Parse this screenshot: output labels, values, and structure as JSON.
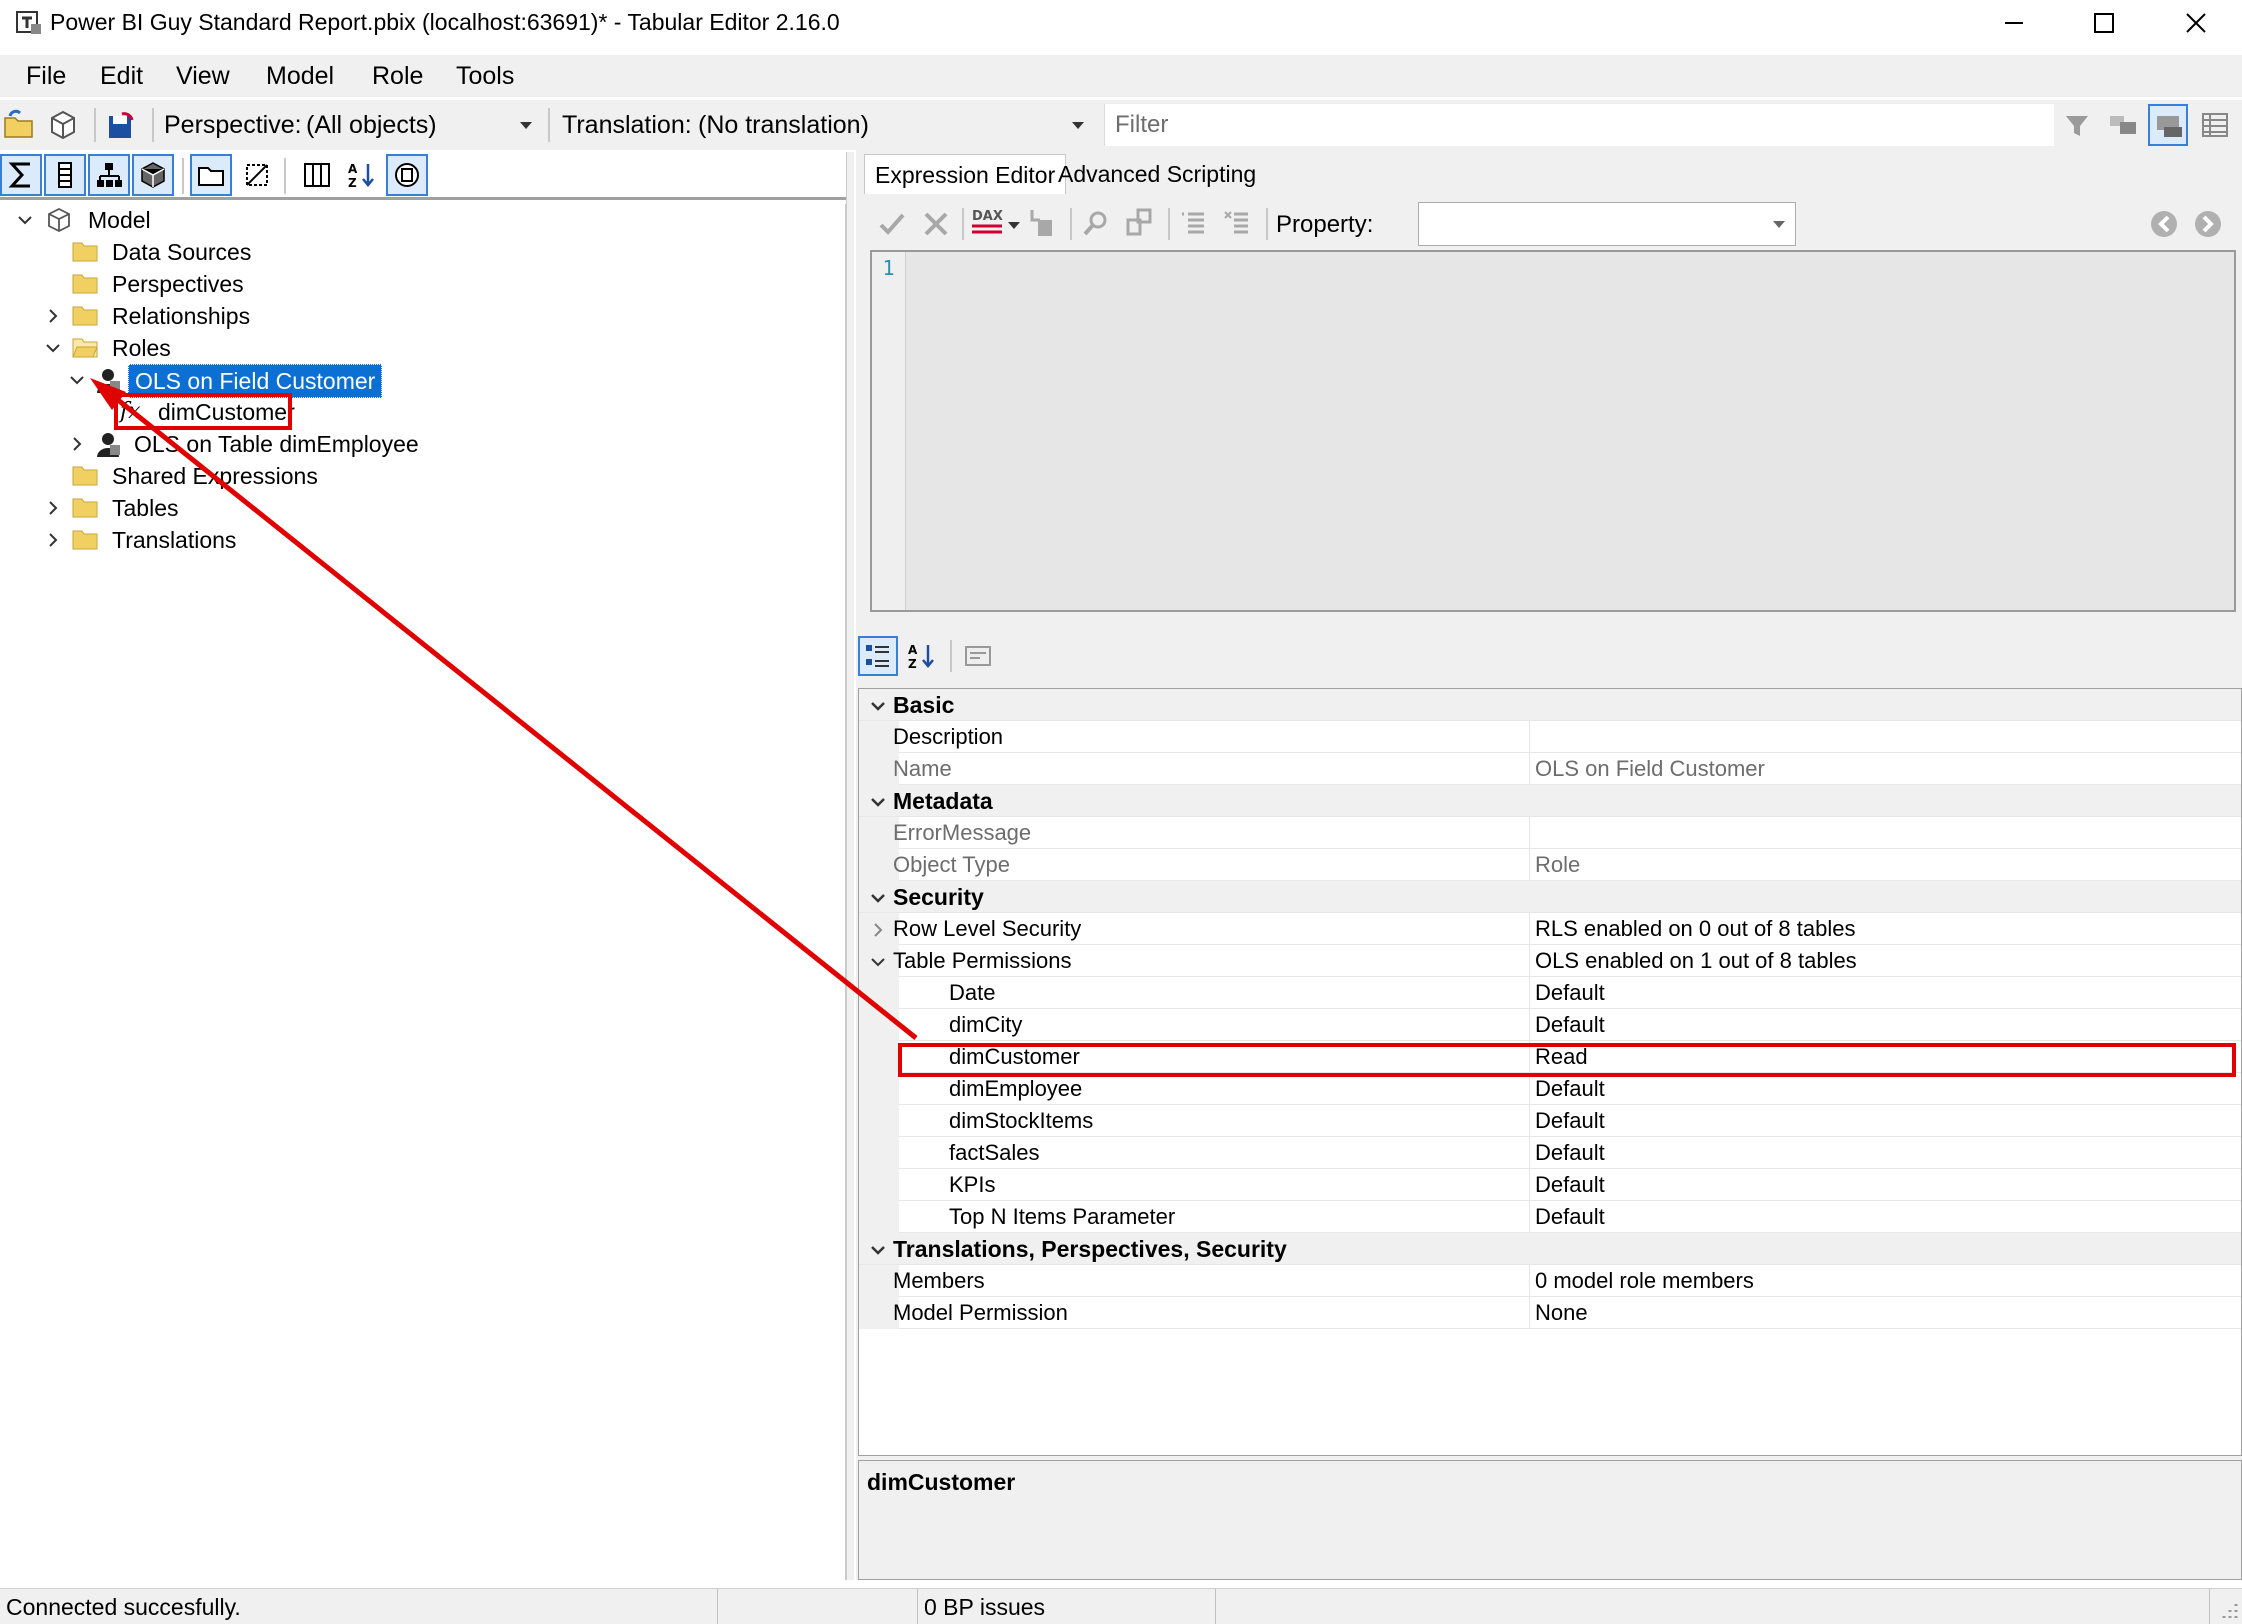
{
  "window": {
    "title": "Power BI Guy Standard Report.pbix (localhost:63691)* - Tabular Editor 2.16.0"
  },
  "menu": {
    "items": [
      {
        "label": "File"
      },
      {
        "label": "Edit"
      },
      {
        "label": "View"
      },
      {
        "label": "Model"
      },
      {
        "label": "Role"
      },
      {
        "label": "Tools"
      }
    ]
  },
  "toolbar": {
    "perspective_label": "Perspective:",
    "perspective_value": "(All objects)",
    "translation_label": "Translation:",
    "translation_value": "(No translation)",
    "filter_placeholder": "Filter"
  },
  "tree": {
    "model": "Model",
    "data_sources": "Data Sources",
    "perspectives": "Perspectives",
    "relationships": "Relationships",
    "roles": "Roles",
    "role_1": "OLS on Field Customer",
    "role_1_child": "dimCustomer",
    "role_2": "OLS on Table dimEmployee",
    "shared_expressions": "Shared Expressions",
    "tables": "Tables",
    "translations": "Translations"
  },
  "expression_editor": {
    "tabs": [
      "Expression Editor",
      "Advanced Scripting"
    ],
    "property_label": "Property:",
    "property_value": "",
    "line_number": "1"
  },
  "property_grid": {
    "basic": {
      "label": "Basic",
      "description_name": "Description",
      "description_value": "",
      "name_name": "Name",
      "name_value": "OLS on Field Customer"
    },
    "metadata": {
      "label": "Metadata",
      "error_name": "ErrorMessage",
      "error_value": "",
      "object_type_name": "Object Type",
      "object_type_value": "Role"
    },
    "security": {
      "label": "Security",
      "rls_name": "Row Level Security",
      "rls_value": "RLS enabled on 0 out of 8 tables",
      "tp_name": "Table Permissions",
      "tp_value": "OLS enabled on 1 out of 8 tables",
      "tables": [
        {
          "name": "Date",
          "value": "Default"
        },
        {
          "name": "dimCity",
          "value": "Default"
        },
        {
          "name": "dimCustomer",
          "value": "Read"
        },
        {
          "name": "dimEmployee",
          "value": "Default"
        },
        {
          "name": "dimStockItems",
          "value": "Default"
        },
        {
          "name": "factSales",
          "value": "Default"
        },
        {
          "name": "KPIs",
          "value": "Default"
        },
        {
          "name": "Top N Items Parameter",
          "value": "Default"
        }
      ]
    },
    "tps": {
      "label": "Translations, Perspectives, Security",
      "members_name": "Members",
      "members_value": "0 model role members",
      "model_permission_name": "Model Permission",
      "model_permission_value": "None"
    },
    "description_panel_title": "dimCustomer"
  },
  "statusbar": {
    "status": "Connected succesfully.",
    "bp_issues": "0 BP issues"
  },
  "colors": {
    "selection": "#0b6fd3",
    "annotation_red": "#e00000",
    "folder_yellow": "#f2cf61"
  }
}
